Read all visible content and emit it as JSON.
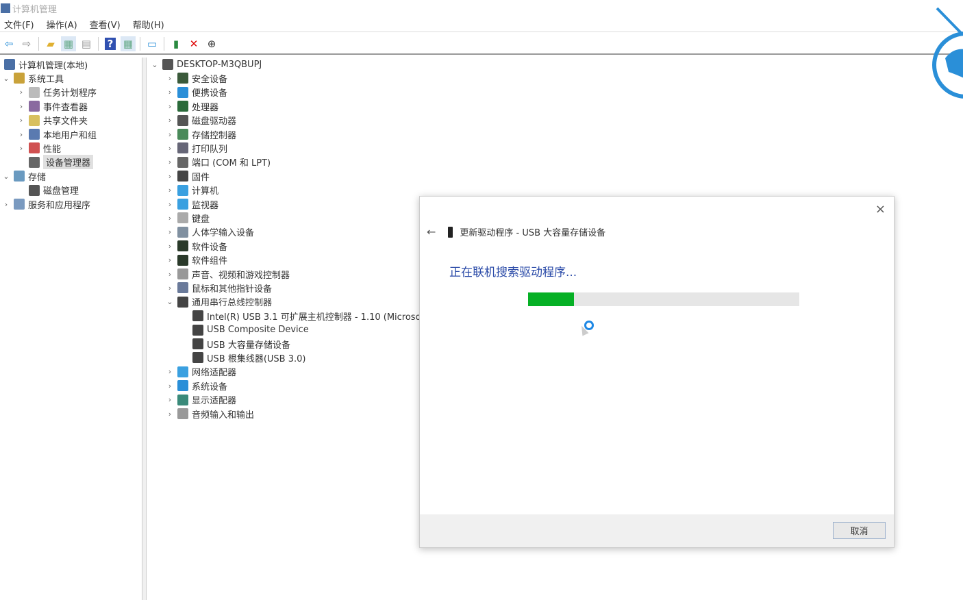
{
  "window": {
    "title": "计算机管理"
  },
  "menu": [
    "文件(F)",
    "操作(A)",
    "查看(V)",
    "帮助(H)"
  ],
  "toolbar": [
    {
      "icon": "back-arrow-icon",
      "glyph": "⇦",
      "color": "#2a8fd8"
    },
    {
      "icon": "forward-arrow-icon",
      "glyph": "⇨",
      "color": "#888"
    },
    {
      "sep": true
    },
    {
      "icon": "up-folder-icon",
      "glyph": "▰",
      "color": "#e0b030"
    },
    {
      "icon": "show-hide-console-tree-icon",
      "glyph": "▦",
      "color": "#6a8",
      "selected": true
    },
    {
      "icon": "properties-icon",
      "glyph": "▤",
      "color": "#999"
    },
    {
      "sep": true
    },
    {
      "icon": "help-icon",
      "glyph": "?",
      "color": "#fff",
      "bg": "#3050b0"
    },
    {
      "icon": "action-pane-icon",
      "glyph": "▦",
      "color": "#6a8",
      "selected": true
    },
    {
      "sep": true
    },
    {
      "icon": "monitor-icon",
      "glyph": "▭",
      "color": "#2a8fd8"
    },
    {
      "sep": true
    },
    {
      "icon": "update-driver-icon",
      "glyph": "▮",
      "color": "#2a8a40"
    },
    {
      "icon": "uninstall-x-icon",
      "glyph": "✕",
      "color": "#d00"
    },
    {
      "icon": "download-circle-icon",
      "glyph": "⊕",
      "color": "#333"
    }
  ],
  "left_tree": [
    {
      "label": "计算机管理(本地)",
      "level": 0,
      "chev": "",
      "icon": "computer-management-icon",
      "color": "#4a6fa5"
    },
    {
      "label": "系统工具",
      "level": 0,
      "chev": "⌄",
      "icon": "tools-icon",
      "color": "#c9a23a",
      "indent": 1
    },
    {
      "label": "任务计划程序",
      "level": 1,
      "chev": "›",
      "icon": "clock-icon",
      "color": "#bbb"
    },
    {
      "label": "事件查看器",
      "level": 1,
      "chev": "›",
      "icon": "event-viewer-icon",
      "color": "#8a6aa0"
    },
    {
      "label": "共享文件夹",
      "level": 1,
      "chev": "›",
      "icon": "shared-folder-icon",
      "color": "#d8c060"
    },
    {
      "label": "本地用户和组",
      "level": 1,
      "chev": "›",
      "icon": "users-icon",
      "color": "#5a7ab0"
    },
    {
      "label": "性能",
      "level": 1,
      "chev": "›",
      "icon": "performance-icon",
      "color": "#d05050"
    },
    {
      "label": "设备管理器",
      "level": 1,
      "chev": "",
      "icon": "device-manager-icon",
      "color": "#666",
      "selected": true
    },
    {
      "label": "存储",
      "level": 0,
      "chev": "⌄",
      "icon": "storage-icon",
      "color": "#6a9ac0",
      "indent": 1
    },
    {
      "label": "磁盘管理",
      "level": 1,
      "chev": "",
      "icon": "disk-management-icon",
      "color": "#555"
    },
    {
      "label": "服务和应用程序",
      "level": 0,
      "chev": "›",
      "icon": "services-icon",
      "color": "#7a9ac0",
      "indent": 1
    }
  ],
  "device_tree": {
    "root": "DESKTOP-M3QBUPJ",
    "items": [
      {
        "label": "安全设备",
        "icon": "security-device-icon",
        "color": "#3a5a3a"
      },
      {
        "label": "便携设备",
        "icon": "portable-device-icon",
        "color": "#2a8fd8"
      },
      {
        "label": "处理器",
        "icon": "processor-icon",
        "color": "#2a6a3a"
      },
      {
        "label": "磁盘驱动器",
        "icon": "disk-drive-icon",
        "color": "#555"
      },
      {
        "label": "存储控制器",
        "icon": "storage-controller-icon",
        "color": "#4a8a5a"
      },
      {
        "label": "打印队列",
        "icon": "printer-icon",
        "color": "#667"
      },
      {
        "label": "端口 (COM 和 LPT)",
        "icon": "port-icon",
        "color": "#666"
      },
      {
        "label": "固件",
        "icon": "firmware-icon",
        "color": "#444"
      },
      {
        "label": "计算机",
        "icon": "computer-icon",
        "color": "#3aa0e0"
      },
      {
        "label": "监视器",
        "icon": "monitor-icon",
        "color": "#3aa0e0"
      },
      {
        "label": "键盘",
        "icon": "keyboard-icon",
        "color": "#aaa"
      },
      {
        "label": "人体学输入设备",
        "icon": "hid-icon",
        "color": "#8090a0"
      },
      {
        "label": "软件设备",
        "icon": "software-device-icon",
        "color": "#2a3a2a"
      },
      {
        "label": "软件组件",
        "icon": "software-component-icon",
        "color": "#2a3a2a"
      },
      {
        "label": "声音、视频和游戏控制器",
        "icon": "speaker-icon",
        "color": "#999"
      },
      {
        "label": "鼠标和其他指针设备",
        "icon": "mouse-icon",
        "color": "#6a7a9a"
      },
      {
        "label": "通用串行总线控制器",
        "icon": "usb-icon",
        "color": "#444",
        "expanded": true,
        "children": [
          "Intel(R) USB 3.1 可扩展主机控制器 - 1.10 (Microso",
          "USB Composite Device",
          "USB 大容量存储设备",
          "USB 根集线器(USB 3.0)"
        ]
      },
      {
        "label": "网络适配器",
        "icon": "network-adapter-icon",
        "color": "#3aa0e0"
      },
      {
        "label": "系统设备",
        "icon": "system-device-icon",
        "color": "#2a8fd8"
      },
      {
        "label": "显示适配器",
        "icon": "display-adapter-icon",
        "color": "#3a8a7a"
      },
      {
        "label": "音频输入和输出",
        "icon": "audio-icon",
        "color": "#999"
      }
    ]
  },
  "dialog": {
    "close": "×",
    "back": "←",
    "title": "更新驱动程序 - USB 大容量存储设备",
    "status": "正在联机搜索驱动程序...",
    "progress_percent": 17,
    "progress_color": "#06b025",
    "cancel_label": "取消"
  }
}
